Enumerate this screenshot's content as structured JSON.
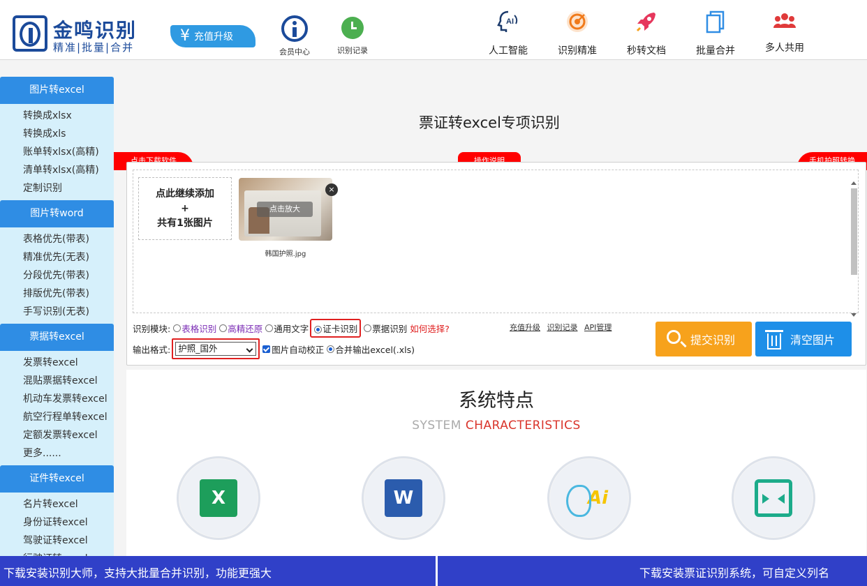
{
  "header": {
    "logo_title": "金鸣识别",
    "logo_subtitle": "精准|批量|合并",
    "recharge_label": "充值升级",
    "member_center": "会员中心",
    "history": "识别记录",
    "features": [
      {
        "label": "人工智能",
        "icon": "ai-icon"
      },
      {
        "label": "识别精准",
        "icon": "target-icon"
      },
      {
        "label": "秒转文档",
        "icon": "rocket-icon"
      },
      {
        "label": "批量合并",
        "icon": "copy-icon"
      },
      {
        "label": "多人共用",
        "icon": "users-icon"
      }
    ]
  },
  "sidebar": {
    "groups": [
      {
        "title": "图片转excel",
        "items": [
          "转换成xlsx",
          "转换成xls",
          "账单转xlsx(高精)",
          "清单转xlsx(高精)",
          "定制识别"
        ]
      },
      {
        "title": "图片转word",
        "items": [
          "表格优先(带表)",
          "精准优先(无表)",
          "分段优先(带表)",
          "排版优先(带表)",
          "手写识别(无表)"
        ]
      },
      {
        "title": "票据转excel",
        "items": [
          "发票转excel",
          "混贴票据转excel",
          "机动车发票转excel",
          "航空行程单转excel",
          "定额发票转excel",
          "更多......"
        ]
      },
      {
        "title": "证件转excel",
        "items": [
          "名片转excel",
          "身份证转excel",
          "驾驶证转excel",
          "行驶证转excel"
        ]
      }
    ]
  },
  "main": {
    "title": "票证转excel专项识别",
    "tab_download": "点击下载软件",
    "tab_instructions": "操作说明",
    "tab_mobile": "手机拍照转换",
    "add_box": {
      "line1": "点此继续添加",
      "line2": "+",
      "line3": "共有1张图片"
    },
    "thumbnail": {
      "zoom": "点击放大",
      "close": "×",
      "filename": "韩国护照.jpg"
    },
    "module_label": "识别模块:",
    "modules": [
      {
        "label": "表格识别",
        "selected": false
      },
      {
        "label": "高精还原",
        "selected": false
      },
      {
        "label": "通用文字",
        "selected": false
      },
      {
        "label": "证卡识别",
        "selected": true
      },
      {
        "label": "票据识别",
        "selected": false
      }
    ],
    "how_to_choose": "如何选择?",
    "links": [
      "充值升级",
      "识别记录",
      "API管理"
    ],
    "output_label": "输出格式:",
    "output_select": "护照_国外",
    "auto_correct": "图片自动校正",
    "merge_output": "合并输出excel(.xls)",
    "submit": "提交识别",
    "clear": "清空图片"
  },
  "features_section": {
    "title": "系统特点",
    "subtitle_a": "SYSTEM ",
    "subtitle_b": "CHARACTERISTICS",
    "icons": [
      "excel-icon",
      "word-icon",
      "ai-brain-icon",
      "merge-icon"
    ],
    "excel_glyph": "X",
    "word_glyph": "W",
    "ai_glyph": "Ai"
  },
  "bottom_bar": {
    "left": "下载安装识别大师，支持大批量合并识别，功能更强大",
    "right": "下载安装票证识别系统，可自定义列名"
  }
}
